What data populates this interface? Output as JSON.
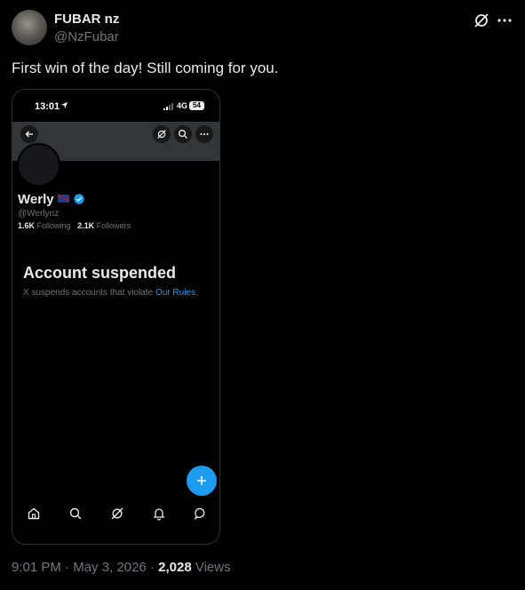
{
  "post": {
    "display_name": "FUBAR nz",
    "handle": "@NzFubar",
    "text": "First win of the day! Still coming for you.",
    "time": "9:01 PM",
    "separator": "·",
    "date": "May 3, 2026",
    "separator2": "·",
    "views_count": "2,028",
    "views_label": "Views"
  },
  "icons": {
    "grok": "grok-icon",
    "more": "more-icon",
    "back": "back-arrow-icon",
    "search": "search-icon",
    "location": "location-arrow-icon"
  },
  "screenshot": {
    "status_time": "13:01",
    "network": "4G",
    "battery": "54",
    "profile": {
      "name": "Werly",
      "handle": "@Werlynz",
      "following_count": "1.6K",
      "following_label": "Following",
      "followers_count": "2.1K",
      "followers_label": "Followers"
    },
    "suspended": {
      "title": "Account suspended",
      "text": "X suspends accounts that violate",
      "link": "Our Rules."
    },
    "nav": [
      "home-icon",
      "search-icon",
      "grok-icon",
      "notifications-icon",
      "messages-icon"
    ]
  },
  "colors": {
    "background": "#000000",
    "text": "#e7e9ea",
    "muted": "#71767b",
    "accent": "#1d9bf0",
    "banner": "#333639"
  }
}
